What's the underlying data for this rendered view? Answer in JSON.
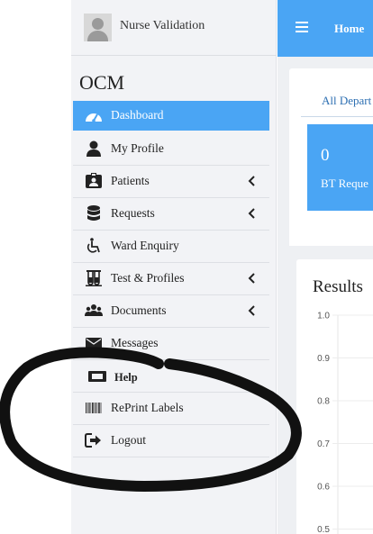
{
  "user": {
    "name": "Nurse Validation"
  },
  "app_title": "OCM",
  "menu": [
    {
      "label": "Dashboard",
      "icon": "dashboard-icon",
      "active": true,
      "has_submenu": false
    },
    {
      "label": "My Profile",
      "icon": "user-icon",
      "active": false,
      "has_submenu": false
    },
    {
      "label": "Patients",
      "icon": "id-badge-icon",
      "active": false,
      "has_submenu": true
    },
    {
      "label": "Requests",
      "icon": "database-icon",
      "active": false,
      "has_submenu": true
    },
    {
      "label": "Ward Enquiry",
      "icon": "wheelchair-icon",
      "active": false,
      "has_submenu": false
    },
    {
      "label": "Test & Profiles",
      "icon": "test-tubes-icon",
      "active": false,
      "has_submenu": true
    },
    {
      "label": "Documents",
      "icon": "users-icon",
      "active": false,
      "has_submenu": true
    },
    {
      "label": "Messages",
      "icon": "envelope-icon",
      "active": false,
      "has_submenu": false
    },
    {
      "label": "Help",
      "icon": "ticket-icon",
      "active": false,
      "has_submenu": false
    },
    {
      "label": "RePrint Labels",
      "icon": "barcode-icon",
      "active": false,
      "has_submenu": false
    },
    {
      "label": "Logout",
      "icon": "sign-out-icon",
      "active": false,
      "has_submenu": false
    }
  ],
  "topbar": {
    "menu_icon": "hamburger-icon",
    "home_label": "Home"
  },
  "departments_tab": {
    "label": "All Depart"
  },
  "card": {
    "value": "0",
    "label": "BT Reque"
  },
  "results_panel": {
    "title": "Results",
    "y_ticks": [
      "1.0",
      "0.9",
      "0.8",
      "0.7",
      "0.6",
      "0.5"
    ]
  },
  "colors": {
    "accent": "#4aa5f4",
    "sidebar_bg": "#f2f3f6",
    "content_bg": "#eef0f3"
  }
}
